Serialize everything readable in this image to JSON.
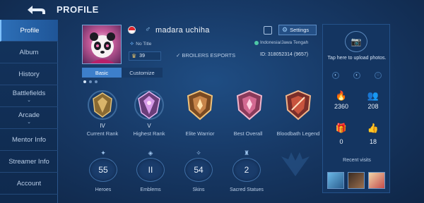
{
  "header": {
    "title": "PROFILE"
  },
  "sidebar": {
    "items": [
      {
        "label": "Profile",
        "active": true
      },
      {
        "label": "Album"
      },
      {
        "label": "History"
      },
      {
        "label": "Battlefields",
        "chevron": "⌄"
      },
      {
        "label": "Arcade",
        "chevron": "⌄"
      },
      {
        "label": "Mentor Info"
      },
      {
        "label": "Streamer Info"
      },
      {
        "label": "Account"
      }
    ]
  },
  "profile": {
    "username": "madara uchiha",
    "gender_symbol": "♂",
    "title": "No Title",
    "location": "Indonesia/Jawa Tengah",
    "rank_points": "39",
    "squad": "✓ BROILERS ESPORTS",
    "player_id": "ID:  318052314 (9657)",
    "settings_label": "Settings"
  },
  "tabs": [
    {
      "label": "Basic",
      "active": true
    },
    {
      "label": "Customize"
    }
  ],
  "badges": [
    {
      "tier": "IV",
      "label": "Current Rank",
      "color": "#c9a45a"
    },
    {
      "tier": "V",
      "label": "Highest Rank",
      "color": "#c79bd6"
    },
    {
      "tier": "",
      "label": "Elite Warrior",
      "color": "#d9a25c"
    },
    {
      "tier": "",
      "label": "Best Overall",
      "color": "#e07ca2"
    },
    {
      "tier": "",
      "label": "Bloodbath Legend",
      "color": "#d16e5c"
    }
  ],
  "stats": [
    {
      "value": "55",
      "label": "Heroes",
      "icon": "hero-icon"
    },
    {
      "value": "II",
      "label": "Emblems",
      "icon": "emblem-icon"
    },
    {
      "value": "54",
      "label": "Skins",
      "icon": "skin-icon"
    },
    {
      "value": "2",
      "label": "Sacred Statues",
      "icon": "statue-icon"
    }
  ],
  "right_panel": {
    "upload_text": "Tap here to upload photos.",
    "counters": [
      {
        "icon": "fire-icon",
        "value": "2360"
      },
      {
        "icon": "followers-icon",
        "value": "208"
      },
      {
        "icon": "gift-icon",
        "value": "0"
      },
      {
        "icon": "like-icon",
        "value": "18"
      }
    ],
    "recent_visits_label": "Recent visits"
  },
  "colors": {
    "accent": "#3d7fcb",
    "background": "#173966"
  }
}
